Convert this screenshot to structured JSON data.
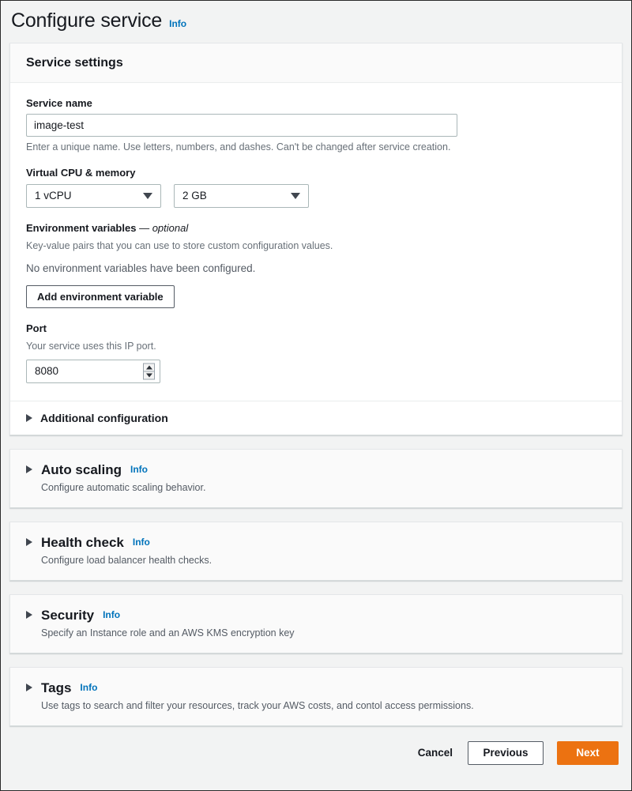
{
  "header": {
    "title": "Configure service",
    "info_label": "Info"
  },
  "service_settings": {
    "panel_title": "Service settings",
    "service_name": {
      "label": "Service name",
      "value": "image-test",
      "placeholder": "",
      "hint": "Enter a unique name. Use letters, numbers, and dashes. Can't be changed after service creation."
    },
    "cpu_memory": {
      "label": "Virtual CPU & memory",
      "cpu_value": "1 vCPU",
      "memory_value": "2 GB"
    },
    "environment_variables": {
      "label": "Environment variables",
      "optional_suffix": "— optional",
      "description": "Key-value pairs that you can use to store custom configuration values.",
      "empty_state": "No environment variables have been configured.",
      "add_button": "Add environment variable"
    },
    "port": {
      "label": "Port",
      "description": "Your service uses this IP port.",
      "value": "8080"
    },
    "additional_configuration": {
      "label": "Additional configuration"
    }
  },
  "sections": [
    {
      "title": "Auto scaling",
      "info_label": "Info",
      "description": "Configure automatic scaling behavior."
    },
    {
      "title": "Health check",
      "info_label": "Info",
      "description": "Configure load balancer health checks."
    },
    {
      "title": "Security",
      "info_label": "Info",
      "description": "Specify an Instance role and an AWS KMS encryption key"
    },
    {
      "title": "Tags",
      "info_label": "Info",
      "description": "Use tags to search and filter your resources, track your AWS costs, and contol access permissions."
    }
  ],
  "footer": {
    "cancel_label": "Cancel",
    "previous_label": "Previous",
    "next_label": "Next"
  },
  "colors": {
    "accent_orange": "#ec7211",
    "link_blue": "#0073bb",
    "page_background": "#f2f3f3"
  }
}
